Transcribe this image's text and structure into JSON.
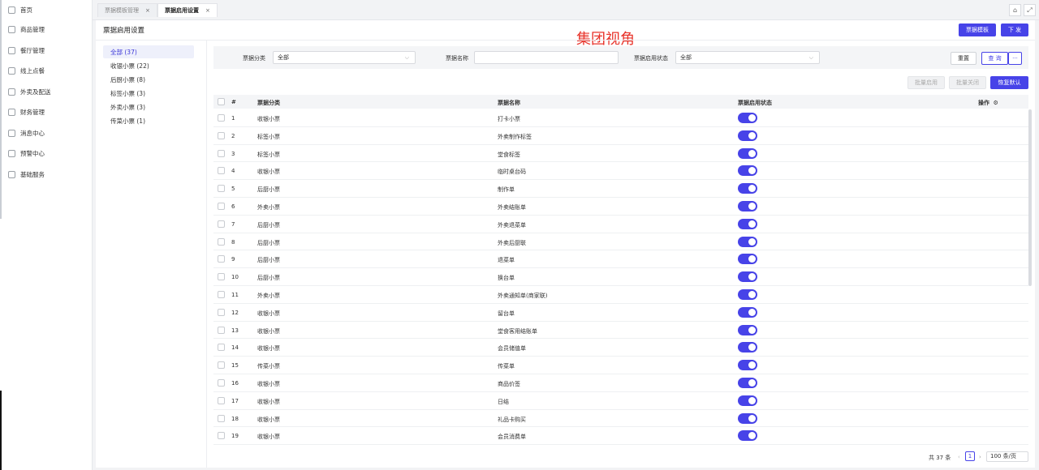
{
  "sidebar": {
    "items": [
      {
        "label": "首页",
        "icon": "home-icon"
      },
      {
        "label": "商品管理",
        "icon": "goods-icon"
      },
      {
        "label": "餐厅管理",
        "icon": "restaurant-icon"
      },
      {
        "label": "线上点餐",
        "icon": "online-order-icon"
      },
      {
        "label": "外卖及配送",
        "icon": "delivery-icon"
      },
      {
        "label": "财务管理",
        "icon": "finance-icon"
      },
      {
        "label": "消息中心",
        "icon": "message-icon"
      },
      {
        "label": "预警中心",
        "icon": "alert-icon"
      },
      {
        "label": "基础服务",
        "icon": "service-icon"
      }
    ]
  },
  "tabs": [
    {
      "label": "票据模板管理",
      "close": "×"
    },
    {
      "label": "票据启用设置",
      "close": "×"
    }
  ],
  "header": {
    "title": "票据启用设置",
    "overlay_title": "集团视角",
    "template_button": "票据模板",
    "issue_button": "下 发"
  },
  "categories": [
    {
      "label": "全部 (37)"
    },
    {
      "label": "收银小票 (22)"
    },
    {
      "label": "后厨小票 (8)"
    },
    {
      "label": "标签小票 (3)"
    },
    {
      "label": "外卖小票 (3)"
    },
    {
      "label": "传菜小票 (1)"
    }
  ],
  "filters": {
    "category_label": "票据分类",
    "category_value": "全部",
    "name_label": "票据名称",
    "name_value": "",
    "status_label": "票据启用状态",
    "status_value": "全部",
    "reset": "重置",
    "query": "查 询",
    "more": "···"
  },
  "actions": {
    "batch_enable": "批量启用",
    "batch_disable": "批量关闭",
    "restore_default": "恢复默认"
  },
  "table": {
    "columns": {
      "index": "#",
      "category": "票据分类",
      "name": "票据名称",
      "status": "票据启用状态",
      "ops": "操作"
    },
    "rows": [
      {
        "no": "1",
        "category": "收银小票",
        "name": "打卡小票",
        "enabled": true
      },
      {
        "no": "2",
        "category": "标签小票",
        "name": "外卖制作标签",
        "enabled": true
      },
      {
        "no": "3",
        "category": "标签小票",
        "name": "堂食标签",
        "enabled": true
      },
      {
        "no": "4",
        "category": "收银小票",
        "name": "临时桌台码",
        "enabled": true
      },
      {
        "no": "5",
        "category": "后厨小票",
        "name": "制作单",
        "enabled": true
      },
      {
        "no": "6",
        "category": "外卖小票",
        "name": "外卖结账单",
        "enabled": true
      },
      {
        "no": "7",
        "category": "后厨小票",
        "name": "外卖退菜单",
        "enabled": true
      },
      {
        "no": "8",
        "category": "后厨小票",
        "name": "外卖后厨联",
        "enabled": true
      },
      {
        "no": "9",
        "category": "后厨小票",
        "name": "退菜单",
        "enabled": true
      },
      {
        "no": "10",
        "category": "后厨小票",
        "name": "换台单",
        "enabled": true
      },
      {
        "no": "11",
        "category": "外卖小票",
        "name": "外卖通知单(商家联)",
        "enabled": true
      },
      {
        "no": "12",
        "category": "收银小票",
        "name": "留台单",
        "enabled": true
      },
      {
        "no": "13",
        "category": "收银小票",
        "name": "堂食客用结账单",
        "enabled": true
      },
      {
        "no": "14",
        "category": "收银小票",
        "name": "会员储值单",
        "enabled": true
      },
      {
        "no": "15",
        "category": "传菜小票",
        "name": "传菜单",
        "enabled": true
      },
      {
        "no": "16",
        "category": "收银小票",
        "name": "商品价签",
        "enabled": true
      },
      {
        "no": "17",
        "category": "收银小票",
        "name": "日结",
        "enabled": true
      },
      {
        "no": "18",
        "category": "收银小票",
        "name": "礼品卡购买",
        "enabled": true
      },
      {
        "no": "19",
        "category": "收银小票",
        "name": "会员消费单",
        "enabled": true
      }
    ]
  },
  "pagination": {
    "total": "共 37 条",
    "prev": "‹",
    "current": "1",
    "next": "›",
    "page_size": "100 条/页"
  },
  "colors": {
    "accent": "#4743e8",
    "overlay_title": "#e8342b"
  }
}
